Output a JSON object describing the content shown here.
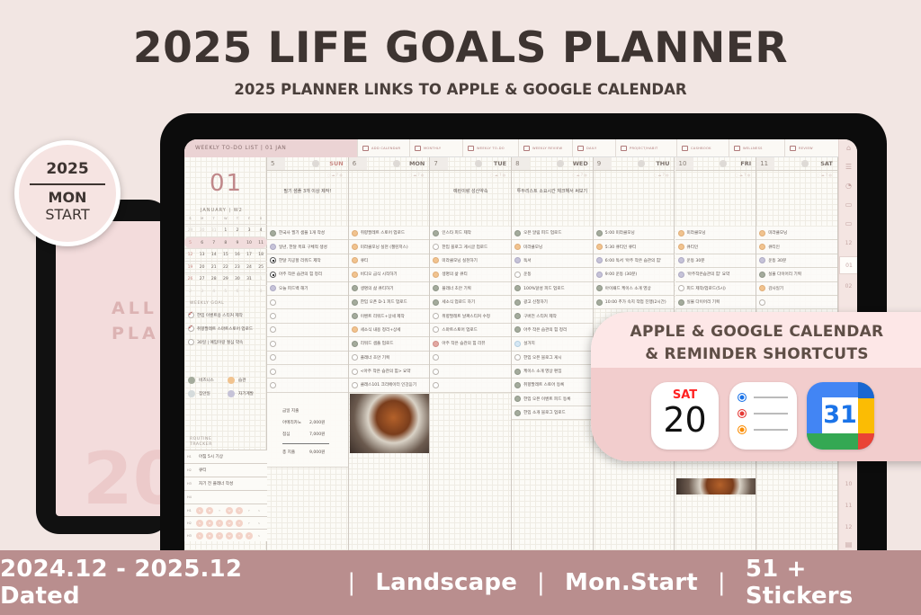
{
  "header": {
    "title": "2025 LIFE GOALS PLANNER",
    "subtitle": "2025 PLANNER LINKS TO APPLE & GOOGLE CALENDAR"
  },
  "badge": {
    "year": "2025",
    "line1": "MON",
    "line2": "START"
  },
  "back_tablet": {
    "line1": "ALL",
    "line2": "PLA",
    "big": "20"
  },
  "planner": {
    "title": "WEEKLY TO-DO LIST | 01 JAN",
    "tabs": [
      {
        "label": "ADD CALENDAR",
        "icon": "add-calendar-icon"
      },
      {
        "label": "MONTHLY",
        "icon": "calendar-icon"
      },
      {
        "label": "WEEKLY TO-DO",
        "icon": "checklist-icon"
      },
      {
        "label": "WEEKLY REVIEW",
        "icon": "review-icon"
      },
      {
        "label": "DAILY",
        "icon": "calendar-icon"
      },
      {
        "label": "PROJECT/HABIT",
        "icon": "project-icon"
      },
      {
        "label": "CASHBOOK",
        "icon": "wallet-icon"
      },
      {
        "label": "WELLNESS",
        "icon": "bowl-icon"
      },
      {
        "label": "REVIEW",
        "icon": "bookmark-icon"
      }
    ],
    "sidebar": {
      "icons": [
        "home-icon",
        "list-icon",
        "chart-icon",
        "calendar-icon",
        "calendar-icon"
      ],
      "months": [
        "12",
        "01",
        "02",
        "10",
        "11",
        "12"
      ],
      "active_month": "01"
    },
    "left": {
      "month_num": "01",
      "month_label": "JANUARY | W2",
      "weekday_heads": [
        "S",
        "M",
        "T",
        "W",
        "T",
        "F",
        "S"
      ],
      "mini_calendar": [
        [
          "29",
          "30",
          "31",
          "1",
          "2",
          "3",
          "4"
        ],
        [
          "5",
          "6",
          "7",
          "8",
          "9",
          "10",
          "11"
        ],
        [
          "12",
          "13",
          "14",
          "15",
          "16",
          "17",
          "18"
        ],
        [
          "19",
          "20",
          "21",
          "22",
          "23",
          "24",
          "25"
        ],
        [
          "26",
          "27",
          "28",
          "29",
          "30",
          "31",
          "1"
        ],
        [
          "2",
          "3",
          "4",
          "5",
          "6",
          "7",
          "8"
        ]
      ],
      "current_week_index": 1,
      "weekly_goal_label": "WEEKLY GOAL",
      "weekly_goals": [
        {
          "text": "한입 이벤트용 스티커 제작",
          "done": true
        },
        {
          "text": "취향팔레트 스마트스토어 업로드",
          "done": true
        },
        {
          "text": "30일 | 예임이랑 절심 약속",
          "done": false
        }
      ],
      "legend": [
        {
          "label": "비즈니스",
          "color": "#a4ab9c"
        },
        {
          "label": "습관",
          "color": "#f1c38f"
        },
        {
          "label": "집안일",
          "color": "#d6dcdc"
        },
        {
          "label": "자기계발",
          "color": "#c6c3d8"
        }
      ],
      "routine_label": "ROUTINE TRACKER",
      "routines": [
        {
          "id": "H1",
          "text": "아침 5시 기상"
        },
        {
          "id": "H2",
          "text": "큐티"
        },
        {
          "id": "H3",
          "text": "자기 전 플래너 작성"
        },
        {
          "id": "H4",
          "text": ""
        }
      ],
      "tracker_rows": [
        {
          "id": "H1",
          "marks": [
            1,
            1,
            0,
            1,
            1,
            0,
            0
          ]
        },
        {
          "id": "H2",
          "marks": [
            1,
            1,
            1,
            1,
            1,
            0,
            0
          ]
        },
        {
          "id": "H3",
          "marks": [
            1,
            1,
            1,
            1,
            1,
            1,
            0
          ]
        }
      ]
    },
    "days": [
      {
        "num": "5",
        "name": "SUN",
        "goal": "필기 샘플 3개 이상 제작!",
        "tasks": [
          [
            "한국사 필기 샘플 1개 작성",
            "green"
          ],
          [
            "일년, 한달 목표 구체적 생성",
            "purple"
          ],
          [
            "한달 치공할 리워드 제작",
            "arrow"
          ],
          [
            "아주 작은 습관의 힘 정리",
            "arrow"
          ],
          [
            "오늘 피드백 해기",
            "purple"
          ],
          [
            "",
            ""
          ],
          [
            "",
            ""
          ],
          [
            "",
            ""
          ],
          [
            "",
            ""
          ],
          [
            "",
            ""
          ],
          [
            "",
            ""
          ],
          [
            "",
            ""
          ]
        ],
        "cashbook": {
          "title": "금일 지출",
          "items": [
            [
              "아메리카노",
              "2,000원"
            ],
            [
              "점심",
              "7,000원"
            ]
          ],
          "total_label": "총 지출",
          "total": "9,000원"
        }
      },
      {
        "num": "6",
        "name": "MON",
        "goal": "",
        "tasks": [
          [
            "취향팔레트 스토어 업로드",
            "orange"
          ],
          [
            "미라클모닝 실천 (챌린저스)",
            "orange"
          ],
          [
            "큐티",
            "orange"
          ],
          [
            "비디오 금식 시작하기",
            "orange"
          ],
          [
            "생명의 삶 큐티하기",
            "green"
          ],
          [
            "한입 오픈 D-1 피드 업로드",
            "green"
          ],
          [
            "이벤트 리워드+상세 제작",
            "green"
          ],
          [
            "세소식 내용 정리+상세",
            "orange"
          ],
          [
            "리워드 샘플 업로드",
            "green"
          ],
          [
            "플래너 초안 기획",
            ""
          ],
          [
            "<아주 작은 습관의 힘> 요약",
            ""
          ],
          [
            "클래스101 크리에이터 인강듣기",
            ""
          ]
        ],
        "photo": true
      },
      {
        "num": "7",
        "name": "TUE",
        "goal": "예린이랑 성산약속",
        "tasks": [
          [
            "인스타 피드 제작",
            "green"
          ],
          [
            "한입 블로그 게시글 업로드",
            ""
          ],
          [
            "미라클모닝 실천하기",
            "orange"
          ],
          [
            "생명의 삶 큐티",
            "orange"
          ],
          [
            "플래너 초안 기획",
            "green"
          ],
          [
            "세소식 업로드 하기",
            "green"
          ],
          [
            "취향팔레트 날짜스티커 수정",
            ""
          ],
          [
            "스마트스토어 업로드",
            ""
          ],
          [
            "아주 작은 습관의 힘 리뷰",
            "red"
          ],
          [
            "",
            ""
          ],
          [
            "",
            ""
          ],
          [
            "",
            ""
          ]
        ]
      },
      {
        "num": "8",
        "name": "WED",
        "goal": "투두리스트 소요시간 체크해서 써보기",
        "tasks": [
          [
            "오픈 알림 피드 업로드",
            "green"
          ],
          [
            "미라클모닝",
            "orange"
          ],
          [
            "독서",
            "purple"
          ],
          [
            "운동",
            ""
          ],
          [
            "100%달성 피드 업로드",
            "green"
          ],
          [
            "광고 신청하기",
            "green"
          ],
          [
            "구버전 스티커 제작",
            "green"
          ],
          [
            "아주 작은 습관의 힘 정리",
            "green"
          ],
          [
            "설거지",
            "blue"
          ],
          [
            "한입 오픈 블로그 게시",
            ""
          ],
          [
            "케이스 소개 영상 편집",
            "green"
          ],
          [
            "취향팔레트 스토어 등록",
            "green"
          ],
          [
            "한입 오픈 이벤트 피드 등록",
            "green"
          ],
          [
            "한입 소개 블로그 업로드",
            "green"
          ]
        ]
      },
      {
        "num": "9",
        "name": "THU",
        "goal": "",
        "tasks": [
          [
            "5:00 미라클모닝",
            "green"
          ],
          [
            "5:30 큐티인 큐티",
            "orange"
          ],
          [
            "6:00 독서 '아주 작은 습관의 힘'",
            "purple"
          ],
          [
            "9:00 운동 (30분)",
            "purple"
          ],
          [
            "아이패드 케이스 소개 영상",
            "green"
          ],
          [
            "10:00 추가 속지 작업 진행(2시간)",
            "green"
          ]
        ]
      },
      {
        "num": "10",
        "name": "FRI",
        "goal": "",
        "tasks": [
          [
            "미라클모닝",
            "orange"
          ],
          [
            "큐티인",
            "orange"
          ],
          [
            "운동 30분",
            "purple"
          ],
          [
            "'아주작은습관의 힘' 요약",
            "purple"
          ],
          [
            "피드 제작/업로드(5시)",
            ""
          ],
          [
            "실물 다이어리 기획",
            "green"
          ]
        ],
        "photo": true
      },
      {
        "num": "11",
        "name": "SAT",
        "goal": "",
        "tasks": [
          [
            "미라클모닝",
            "orange"
          ],
          [
            "큐티인",
            "orange"
          ],
          [
            "운동 30분",
            "purple"
          ],
          [
            "실물 다이어리 기획",
            "green"
          ],
          [
            "감사일기",
            "orange"
          ],
          [
            "",
            ""
          ]
        ]
      }
    ]
  },
  "callout": {
    "line1": "APPLE & GOOGLE CALENDAR",
    "line2": "& REMINDER SHORTCUTS",
    "apple_calendar": {
      "day": "SAT",
      "date": "20"
    },
    "google_calendar": {
      "date": "31"
    },
    "reminder_colors": [
      "#1a73e8",
      "#e53935",
      "#fb8c00"
    ]
  },
  "footer": {
    "items": [
      "2024.12 - 2025.12 Dated",
      "Landscape",
      "Mon.Start",
      "51 + Stickers"
    ],
    "separator": "|"
  },
  "colors": {
    "background": "#f2e6e3",
    "footer": "#b98e8e",
    "accent_pink": "#ebd3d4"
  }
}
